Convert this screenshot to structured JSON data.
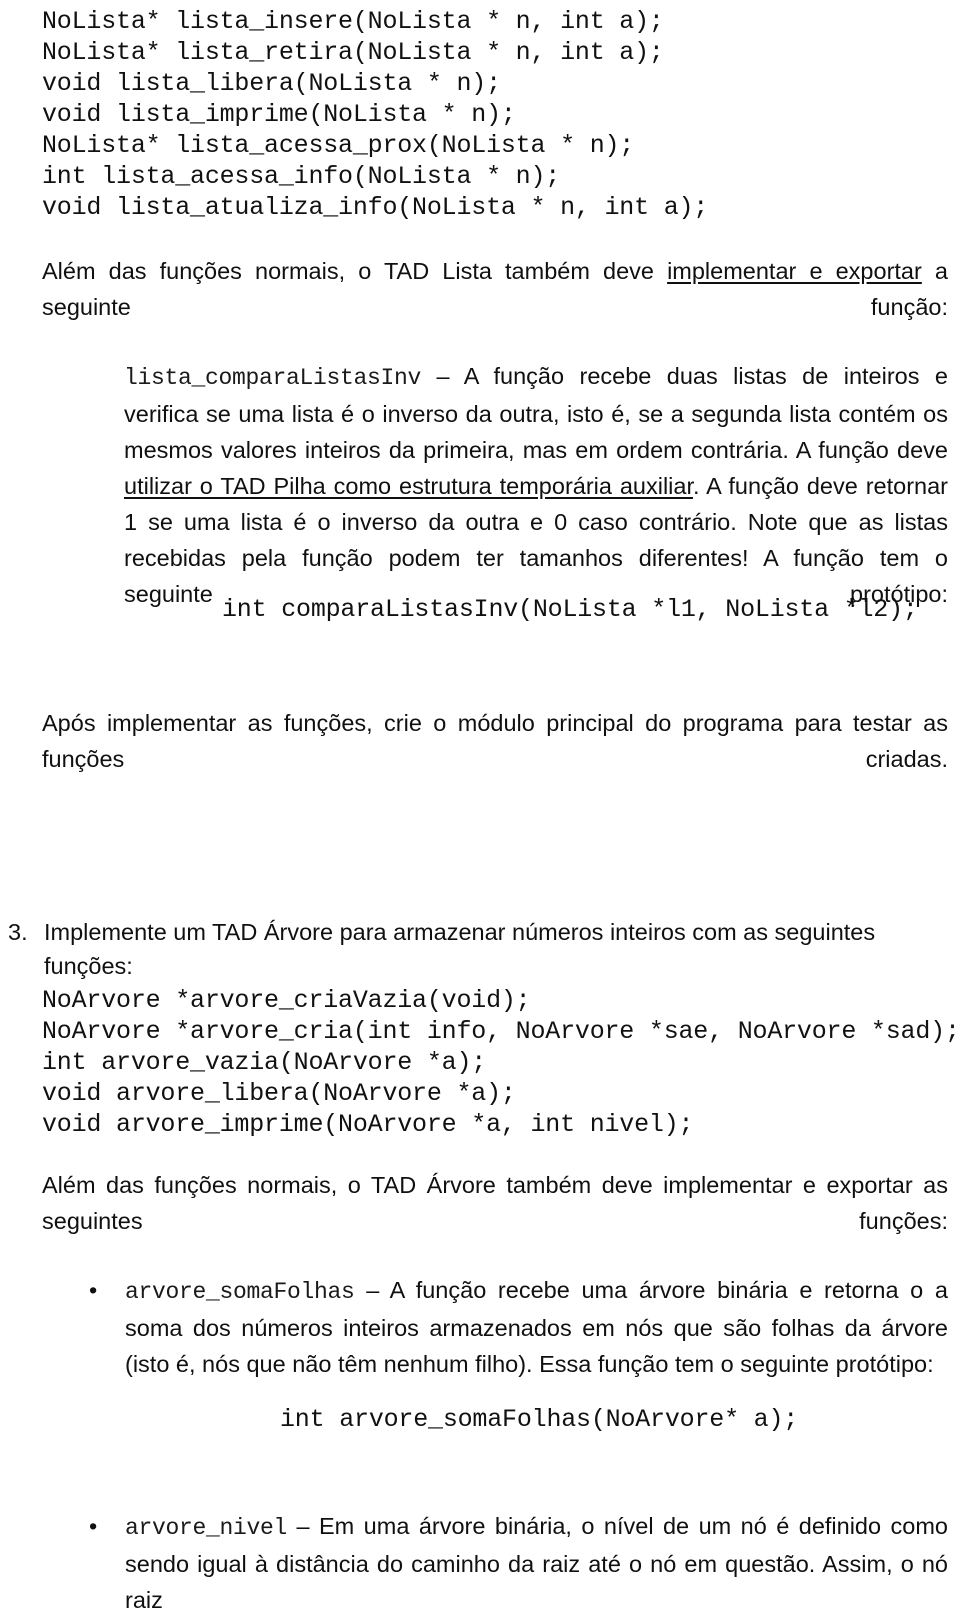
{
  "document": {
    "language": "pt-BR",
    "kind": "assignment-handout",
    "text_color": "#101010",
    "background_color": "#ffffff"
  },
  "lista_prototypes": {
    "lines": [
      "NoLista* lista_insere(NoLista * n, int a);",
      "NoLista* lista_retira(NoLista * n, int a);",
      "void lista_libera(NoLista * n);",
      "void lista_imprime(NoLista * n);",
      "NoLista* lista_acessa_prox(NoLista * n);",
      "int lista_acessa_info(NoLista * n);",
      "void lista_atualiza_info(NoLista * n, int a);"
    ]
  },
  "lista_export_paragraph": {
    "before": "Além das funções normais, o TAD Lista também deve ",
    "underlined": "implementar e exportar",
    "after": " a seguinte função:"
  },
  "compara_listas_item": {
    "name": "lista_comparaListasInv",
    "dash": " – ",
    "text_part1": "A função recebe duas listas de inteiros e verifica se uma lista é o inverso da outra, isto é, se a segunda lista contém os mesmos valores inteiros da primeira, mas em ordem contrária. A função deve ",
    "underlined": "utilizar o TAD Pilha como estrutura temporária auxiliar",
    "text_part2": ". A função deve retornar 1 se uma lista é o inverso da outra e 0 caso contrário. Note que as listas recebidas pela função podem ter tamanhos diferentes! A função tem o seguinte protótipo:"
  },
  "compara_listas_prototype": "int comparaListasInv(NoLista *l1, NoLista *l2);",
  "main_module_paragraph": "Após implementar as funções, crie o módulo principal do programa para testar as funções criadas.",
  "arvore_item": {
    "number": "3.",
    "text": "Implemente um TAD Árvore para armazenar números inteiros com as seguintes funções:"
  },
  "arvore_prototypes": {
    "lines": [
      "NoArvore *arvore_criaVazia(void);",
      "NoArvore *arvore_cria(int info, NoArvore *sae, NoArvore *sad);",
      "int arvore_vazia(NoArvore *a);",
      "void arvore_libera(NoArvore *a);",
      "void arvore_imprime(NoArvore *a, int nivel);"
    ]
  },
  "arvore_export_paragraph": "Além das funções normais, o TAD Árvore também deve implementar e exportar as seguintes funções:",
  "bullets": [
    {
      "marker": "•",
      "name": "arvore_somaFolhas",
      "dash": " – ",
      "text": "A função recebe uma árvore binária e retorna o a soma dos números inteiros armazenados em nós que são folhas da árvore (isto é, nós que não têm nenhum filho). Essa função tem o seguinte protótipo:"
    },
    {
      "marker": "•",
      "name": "arvore_nivel",
      "dash": " – ",
      "text": "Em uma árvore binária, o nível de um nó é definido como sendo igual à distância do caminho da raiz até o nó em questão. Assim, o nó raiz"
    }
  ],
  "soma_folhas_prototype": "int arvore_somaFolhas(NoArvore* a);"
}
